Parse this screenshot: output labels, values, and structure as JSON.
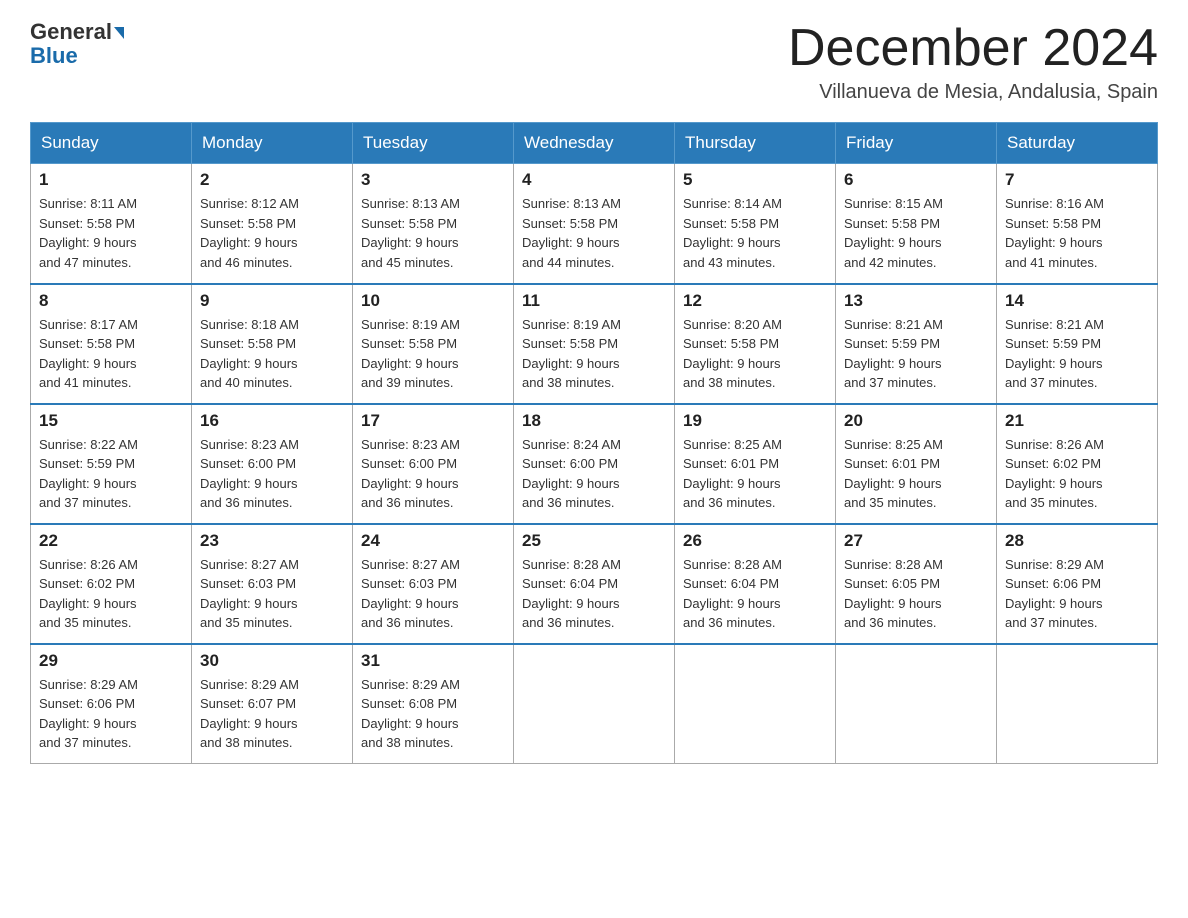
{
  "header": {
    "logo_line1": "General",
    "logo_line2": "Blue",
    "month_title": "December 2024",
    "location": "Villanueva de Mesia, Andalusia, Spain"
  },
  "days_of_week": [
    "Sunday",
    "Monday",
    "Tuesday",
    "Wednesday",
    "Thursday",
    "Friday",
    "Saturday"
  ],
  "weeks": [
    [
      {
        "day": "1",
        "sunrise": "8:11 AM",
        "sunset": "5:58 PM",
        "daylight": "9 hours and 47 minutes."
      },
      {
        "day": "2",
        "sunrise": "8:12 AM",
        "sunset": "5:58 PM",
        "daylight": "9 hours and 46 minutes."
      },
      {
        "day": "3",
        "sunrise": "8:13 AM",
        "sunset": "5:58 PM",
        "daylight": "9 hours and 45 minutes."
      },
      {
        "day": "4",
        "sunrise": "8:13 AM",
        "sunset": "5:58 PM",
        "daylight": "9 hours and 44 minutes."
      },
      {
        "day": "5",
        "sunrise": "8:14 AM",
        "sunset": "5:58 PM",
        "daylight": "9 hours and 43 minutes."
      },
      {
        "day": "6",
        "sunrise": "8:15 AM",
        "sunset": "5:58 PM",
        "daylight": "9 hours and 42 minutes."
      },
      {
        "day": "7",
        "sunrise": "8:16 AM",
        "sunset": "5:58 PM",
        "daylight": "9 hours and 41 minutes."
      }
    ],
    [
      {
        "day": "8",
        "sunrise": "8:17 AM",
        "sunset": "5:58 PM",
        "daylight": "9 hours and 41 minutes."
      },
      {
        "day": "9",
        "sunrise": "8:18 AM",
        "sunset": "5:58 PM",
        "daylight": "9 hours and 40 minutes."
      },
      {
        "day": "10",
        "sunrise": "8:19 AM",
        "sunset": "5:58 PM",
        "daylight": "9 hours and 39 minutes."
      },
      {
        "day": "11",
        "sunrise": "8:19 AM",
        "sunset": "5:58 PM",
        "daylight": "9 hours and 38 minutes."
      },
      {
        "day": "12",
        "sunrise": "8:20 AM",
        "sunset": "5:58 PM",
        "daylight": "9 hours and 38 minutes."
      },
      {
        "day": "13",
        "sunrise": "8:21 AM",
        "sunset": "5:59 PM",
        "daylight": "9 hours and 37 minutes."
      },
      {
        "day": "14",
        "sunrise": "8:21 AM",
        "sunset": "5:59 PM",
        "daylight": "9 hours and 37 minutes."
      }
    ],
    [
      {
        "day": "15",
        "sunrise": "8:22 AM",
        "sunset": "5:59 PM",
        "daylight": "9 hours and 37 minutes."
      },
      {
        "day": "16",
        "sunrise": "8:23 AM",
        "sunset": "6:00 PM",
        "daylight": "9 hours and 36 minutes."
      },
      {
        "day": "17",
        "sunrise": "8:23 AM",
        "sunset": "6:00 PM",
        "daylight": "9 hours and 36 minutes."
      },
      {
        "day": "18",
        "sunrise": "8:24 AM",
        "sunset": "6:00 PM",
        "daylight": "9 hours and 36 minutes."
      },
      {
        "day": "19",
        "sunrise": "8:25 AM",
        "sunset": "6:01 PM",
        "daylight": "9 hours and 36 minutes."
      },
      {
        "day": "20",
        "sunrise": "8:25 AM",
        "sunset": "6:01 PM",
        "daylight": "9 hours and 35 minutes."
      },
      {
        "day": "21",
        "sunrise": "8:26 AM",
        "sunset": "6:02 PM",
        "daylight": "9 hours and 35 minutes."
      }
    ],
    [
      {
        "day": "22",
        "sunrise": "8:26 AM",
        "sunset": "6:02 PM",
        "daylight": "9 hours and 35 minutes."
      },
      {
        "day": "23",
        "sunrise": "8:27 AM",
        "sunset": "6:03 PM",
        "daylight": "9 hours and 35 minutes."
      },
      {
        "day": "24",
        "sunrise": "8:27 AM",
        "sunset": "6:03 PM",
        "daylight": "9 hours and 36 minutes."
      },
      {
        "day": "25",
        "sunrise": "8:28 AM",
        "sunset": "6:04 PM",
        "daylight": "9 hours and 36 minutes."
      },
      {
        "day": "26",
        "sunrise": "8:28 AM",
        "sunset": "6:04 PM",
        "daylight": "9 hours and 36 minutes."
      },
      {
        "day": "27",
        "sunrise": "8:28 AM",
        "sunset": "6:05 PM",
        "daylight": "9 hours and 36 minutes."
      },
      {
        "day": "28",
        "sunrise": "8:29 AM",
        "sunset": "6:06 PM",
        "daylight": "9 hours and 37 minutes."
      }
    ],
    [
      {
        "day": "29",
        "sunrise": "8:29 AM",
        "sunset": "6:06 PM",
        "daylight": "9 hours and 37 minutes."
      },
      {
        "day": "30",
        "sunrise": "8:29 AM",
        "sunset": "6:07 PM",
        "daylight": "9 hours and 38 minutes."
      },
      {
        "day": "31",
        "sunrise": "8:29 AM",
        "sunset": "6:08 PM",
        "daylight": "9 hours and 38 minutes."
      },
      null,
      null,
      null,
      null
    ]
  ],
  "labels": {
    "sunrise": "Sunrise:",
    "sunset": "Sunset:",
    "daylight": "Daylight:"
  }
}
